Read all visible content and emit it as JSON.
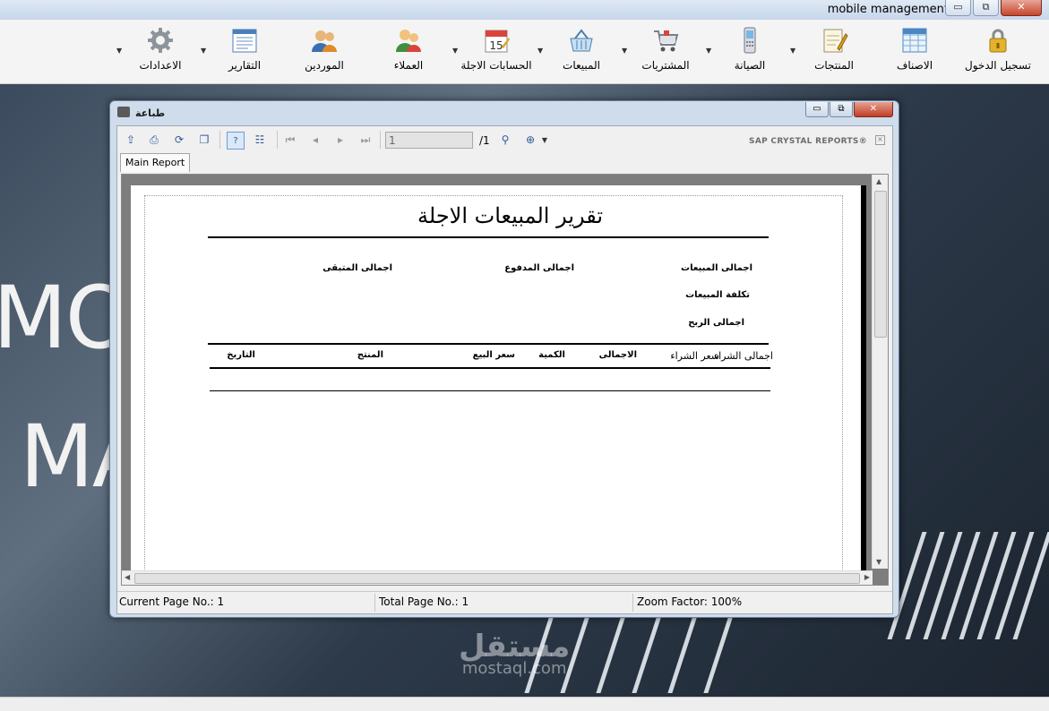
{
  "window": {
    "title": "mobile management",
    "minimize": "▭",
    "maximize": "⧉",
    "close": "✕"
  },
  "menu": [
    {
      "label": "تسجيل الدخول",
      "icon": "lock-icon"
    },
    {
      "label": "الاصناف",
      "icon": "grid-icon"
    },
    {
      "label": "المنتجات",
      "icon": "notepad-icon"
    },
    {
      "label": "الصيانة",
      "icon": "mobile-phone-icon"
    },
    {
      "label": "المشتريات",
      "icon": "shopping-cart-icon"
    },
    {
      "label": "المبيعات",
      "icon": "basket-icon"
    },
    {
      "label": "الحسابات الاجلة",
      "icon": "calendar-icon"
    },
    {
      "label": "العملاء",
      "icon": "customers-icon"
    },
    {
      "label": "الموردين",
      "icon": "suppliers-icon"
    },
    {
      "label": "التقارير",
      "icon": "report-icon"
    },
    {
      "label": "الاعدادات",
      "icon": "gear-icon"
    }
  ],
  "background": {
    "text1": "MOB",
    "text2": "MA",
    "watermark": "مستقل",
    "watermark_sub": "mostaql.com"
  },
  "dialog": {
    "title": "طباعة",
    "toolbar": {
      "page_value": "1",
      "page_total": "/1",
      "brand": "SAP CRYSTAL REPORTS®",
      "tab": "Main Report"
    },
    "report": {
      "title": "تقرير المبيعات الاجلة",
      "total_sales": "اجمالى المبيعات",
      "total_paid": "اجمالى المدفوع",
      "total_remaining": "اجمالى المتبقى",
      "sales_cost": "تكلفة المبيعات",
      "total_profit": "اجمالى الربح",
      "columns": {
        "total_purchase": "اجمالى الشراء",
        "purchase_price": "سعر الشراء",
        "total": "الاجمالى",
        "quantity": "الكمية",
        "sale_price": "سعر البيع",
        "product": "المنتج",
        "date": "التاريخ"
      }
    },
    "status": {
      "current_page": "Current Page No.: 1",
      "total_page": "Total Page No.: 1",
      "zoom": "Zoom Factor: 100%"
    }
  }
}
